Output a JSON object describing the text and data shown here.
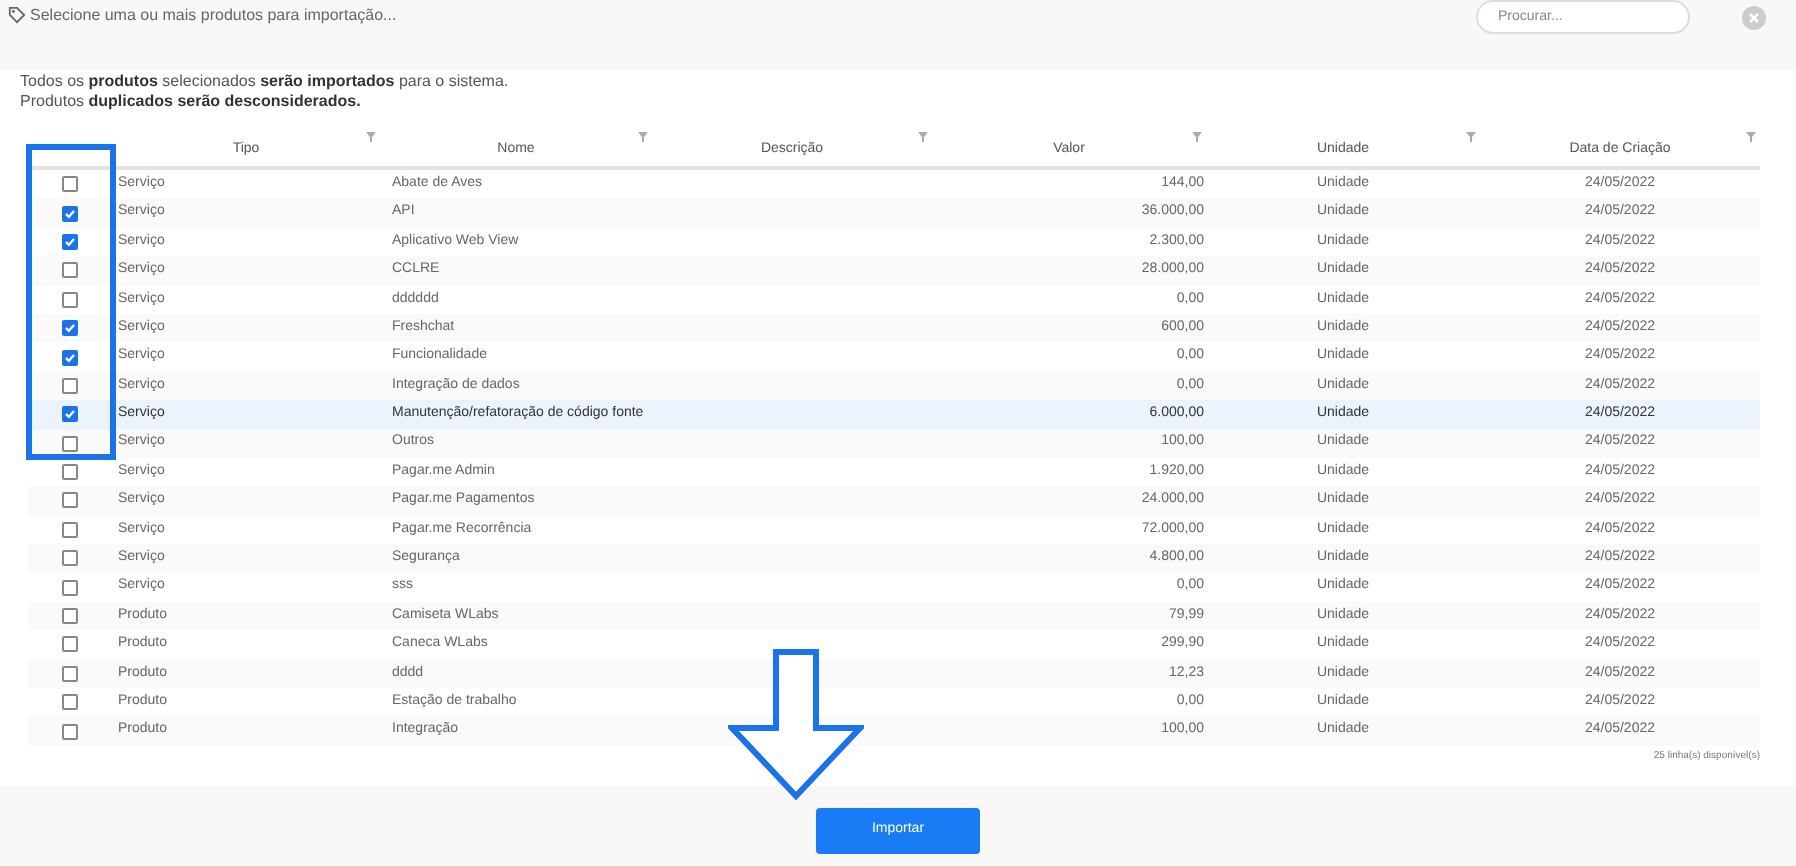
{
  "dialog": {
    "title": "Selecione uma ou mais produtos para importação...",
    "search": {
      "placeholder": "Procurar..."
    }
  },
  "notice": [
    "Todos os **produtos** selecionados **serão importados** para o sistema.",
    "Produtos **duplicados serão desconsiderados.**"
  ],
  "table": {
    "columns": [
      "Tipo",
      "Nome",
      "Descrição",
      "Valor",
      "Unidade",
      "Data de Criação"
    ],
    "rows": [
      {
        "checked": false,
        "hovered": false,
        "cells": [
          "Serviço",
          "Abate de Aves",
          "",
          "144,00",
          "Unidade",
          "24/05/2022"
        ]
      },
      {
        "checked": true,
        "hovered": false,
        "cells": [
          "Serviço",
          "API",
          "",
          "36.000,00",
          "Unidade",
          "24/05/2022"
        ]
      },
      {
        "checked": true,
        "hovered": false,
        "cells": [
          "Serviço",
          "Aplicativo Web View",
          "",
          "2.300,00",
          "Unidade",
          "24/05/2022"
        ]
      },
      {
        "checked": false,
        "hovered": false,
        "cells": [
          "Serviço",
          "CCLRE",
          "",
          "28.000,00",
          "Unidade",
          "24/05/2022"
        ]
      },
      {
        "checked": false,
        "hovered": false,
        "cells": [
          "Serviço",
          "dddddd",
          "",
          "0,00",
          "Unidade",
          "24/05/2022"
        ]
      },
      {
        "checked": true,
        "hovered": false,
        "cells": [
          "Serviço",
          "Freshchat",
          "",
          "600,00",
          "Unidade",
          "24/05/2022"
        ]
      },
      {
        "checked": true,
        "hovered": false,
        "cells": [
          "Serviço",
          "Funcionalidade",
          "",
          "0,00",
          "Unidade",
          "24/05/2022"
        ]
      },
      {
        "checked": false,
        "hovered": false,
        "cells": [
          "Serviço",
          "Integração de dados",
          "",
          "0,00",
          "Unidade",
          "24/05/2022"
        ]
      },
      {
        "checked": true,
        "hovered": true,
        "cells": [
          "Serviço",
          "Manutenção/refatoração de código fonte",
          "",
          "6.000,00",
          "Unidade",
          "24/05/2022"
        ]
      },
      {
        "checked": false,
        "hovered": false,
        "cells": [
          "Serviço",
          "Outros",
          "",
          "100,00",
          "Unidade",
          "24/05/2022"
        ]
      },
      {
        "checked": false,
        "hovered": false,
        "cells": [
          "Serviço",
          "Pagar.me Admin",
          "",
          "1.920,00",
          "Unidade",
          "24/05/2022"
        ]
      },
      {
        "checked": false,
        "hovered": false,
        "cells": [
          "Serviço",
          "Pagar.me Pagamentos",
          "",
          "24.000,00",
          "Unidade",
          "24/05/2022"
        ]
      },
      {
        "checked": false,
        "hovered": false,
        "cells": [
          "Serviço",
          "Pagar.me Recorrência",
          "",
          "72.000,00",
          "Unidade",
          "24/05/2022"
        ]
      },
      {
        "checked": false,
        "hovered": false,
        "cells": [
          "Serviço",
          "Segurança",
          "",
          "4.800,00",
          "Unidade",
          "24/05/2022"
        ]
      },
      {
        "checked": false,
        "hovered": false,
        "cells": [
          "Serviço",
          "sss",
          "",
          "0,00",
          "Unidade",
          "24/05/2022"
        ]
      },
      {
        "checked": false,
        "hovered": false,
        "cells": [
          "Produto",
          "Camiseta WLabs",
          "",
          "79,99",
          "Unidade",
          "24/05/2022"
        ]
      },
      {
        "checked": false,
        "hovered": false,
        "cells": [
          "Produto",
          "Caneca WLabs",
          "",
          "299,90",
          "Unidade",
          "24/05/2022"
        ]
      },
      {
        "checked": false,
        "hovered": false,
        "cells": [
          "Produto",
          "dddd",
          "",
          "12,23",
          "Unidade",
          "24/05/2022"
        ]
      },
      {
        "checked": false,
        "hovered": false,
        "cells": [
          "Produto",
          "Estação de trabalho",
          "",
          "0,00",
          "Unidade",
          "24/05/2022"
        ]
      },
      {
        "checked": false,
        "hovered": false,
        "cells": [
          "Produto",
          "Integração",
          "",
          "100,00",
          "Unidade",
          "24/05/2022"
        ]
      }
    ],
    "row_count": "25 linha(s) disponível(s)"
  },
  "import_button": "Importar"
}
